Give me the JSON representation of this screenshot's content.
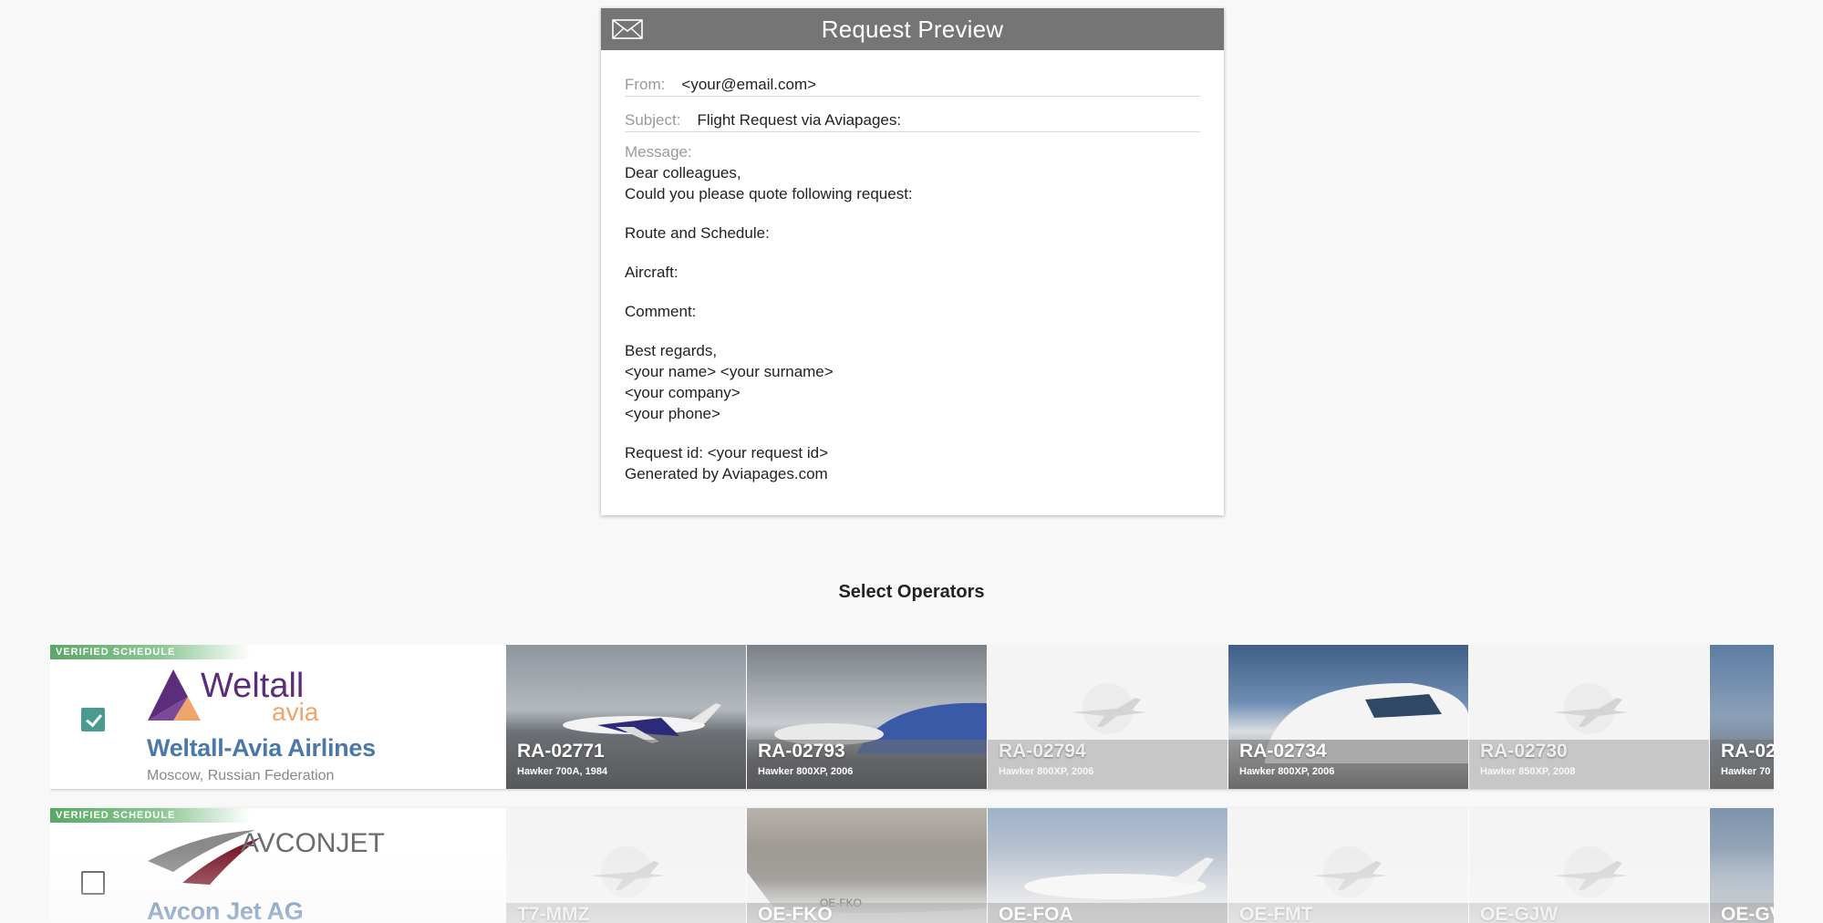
{
  "preview": {
    "title": "Request Preview",
    "icon": "envelope-icon",
    "from_label": "From:",
    "from_value": "<your@email.com>",
    "subject_label": "Subject:",
    "subject_value": "Flight Request via Aviapages:",
    "message_label": "Message:",
    "message_lines": {
      "l1": "Dear colleagues,",
      "l2": "Could you please quote following request:",
      "l3": "Route and Schedule:",
      "l4": "Aircraft:",
      "l5": "Comment:",
      "l6": "Best regards,",
      "l7": "<your name> <your surname>",
      "l8": "<your company>",
      "l9": "<your phone>",
      "l10": "Request id: <your request id>",
      "l11": "Generated by Aviapages.com"
    }
  },
  "section_title": "Select Operators",
  "colors": {
    "accent": "#4a9a90",
    "operator_name": "#4a78a8",
    "badge": "#5aa865",
    "header": "#757575"
  },
  "operators": [
    {
      "badge": "VERIFIED SCHEDULE",
      "checked": true,
      "logo_text": "Weltall",
      "logo_sub": "avia",
      "name": "Weltall-Avia Airlines",
      "location": "Moscow, Russian Federation",
      "aircraft": [
        {
          "reg": "RA-02771",
          "model": "Hawker 700A, 1984"
        },
        {
          "reg": "RA-02793",
          "model": "Hawker 800XP, 2006"
        },
        {
          "reg": "RA-02794",
          "model": "Hawker 800XP, 2006"
        },
        {
          "reg": "RA-02734",
          "model": "Hawker 800XP, 2006"
        },
        {
          "reg": "RA-02730",
          "model": "Hawker 850XP, 2008"
        },
        {
          "reg": "RA-02",
          "model": "Hawker 70"
        }
      ]
    },
    {
      "badge": "VERIFIED SCHEDULE",
      "checked": false,
      "logo_text": "AVCONJET",
      "name": "Avcon Jet AG",
      "aircraft": [
        {
          "reg": "T7-MMZ"
        },
        {
          "reg": "OE-FKO"
        },
        {
          "reg": "OE-FOA"
        },
        {
          "reg": "OE-FMT"
        },
        {
          "reg": "OE-GJW"
        },
        {
          "reg": "OE-GV"
        }
      ]
    }
  ]
}
